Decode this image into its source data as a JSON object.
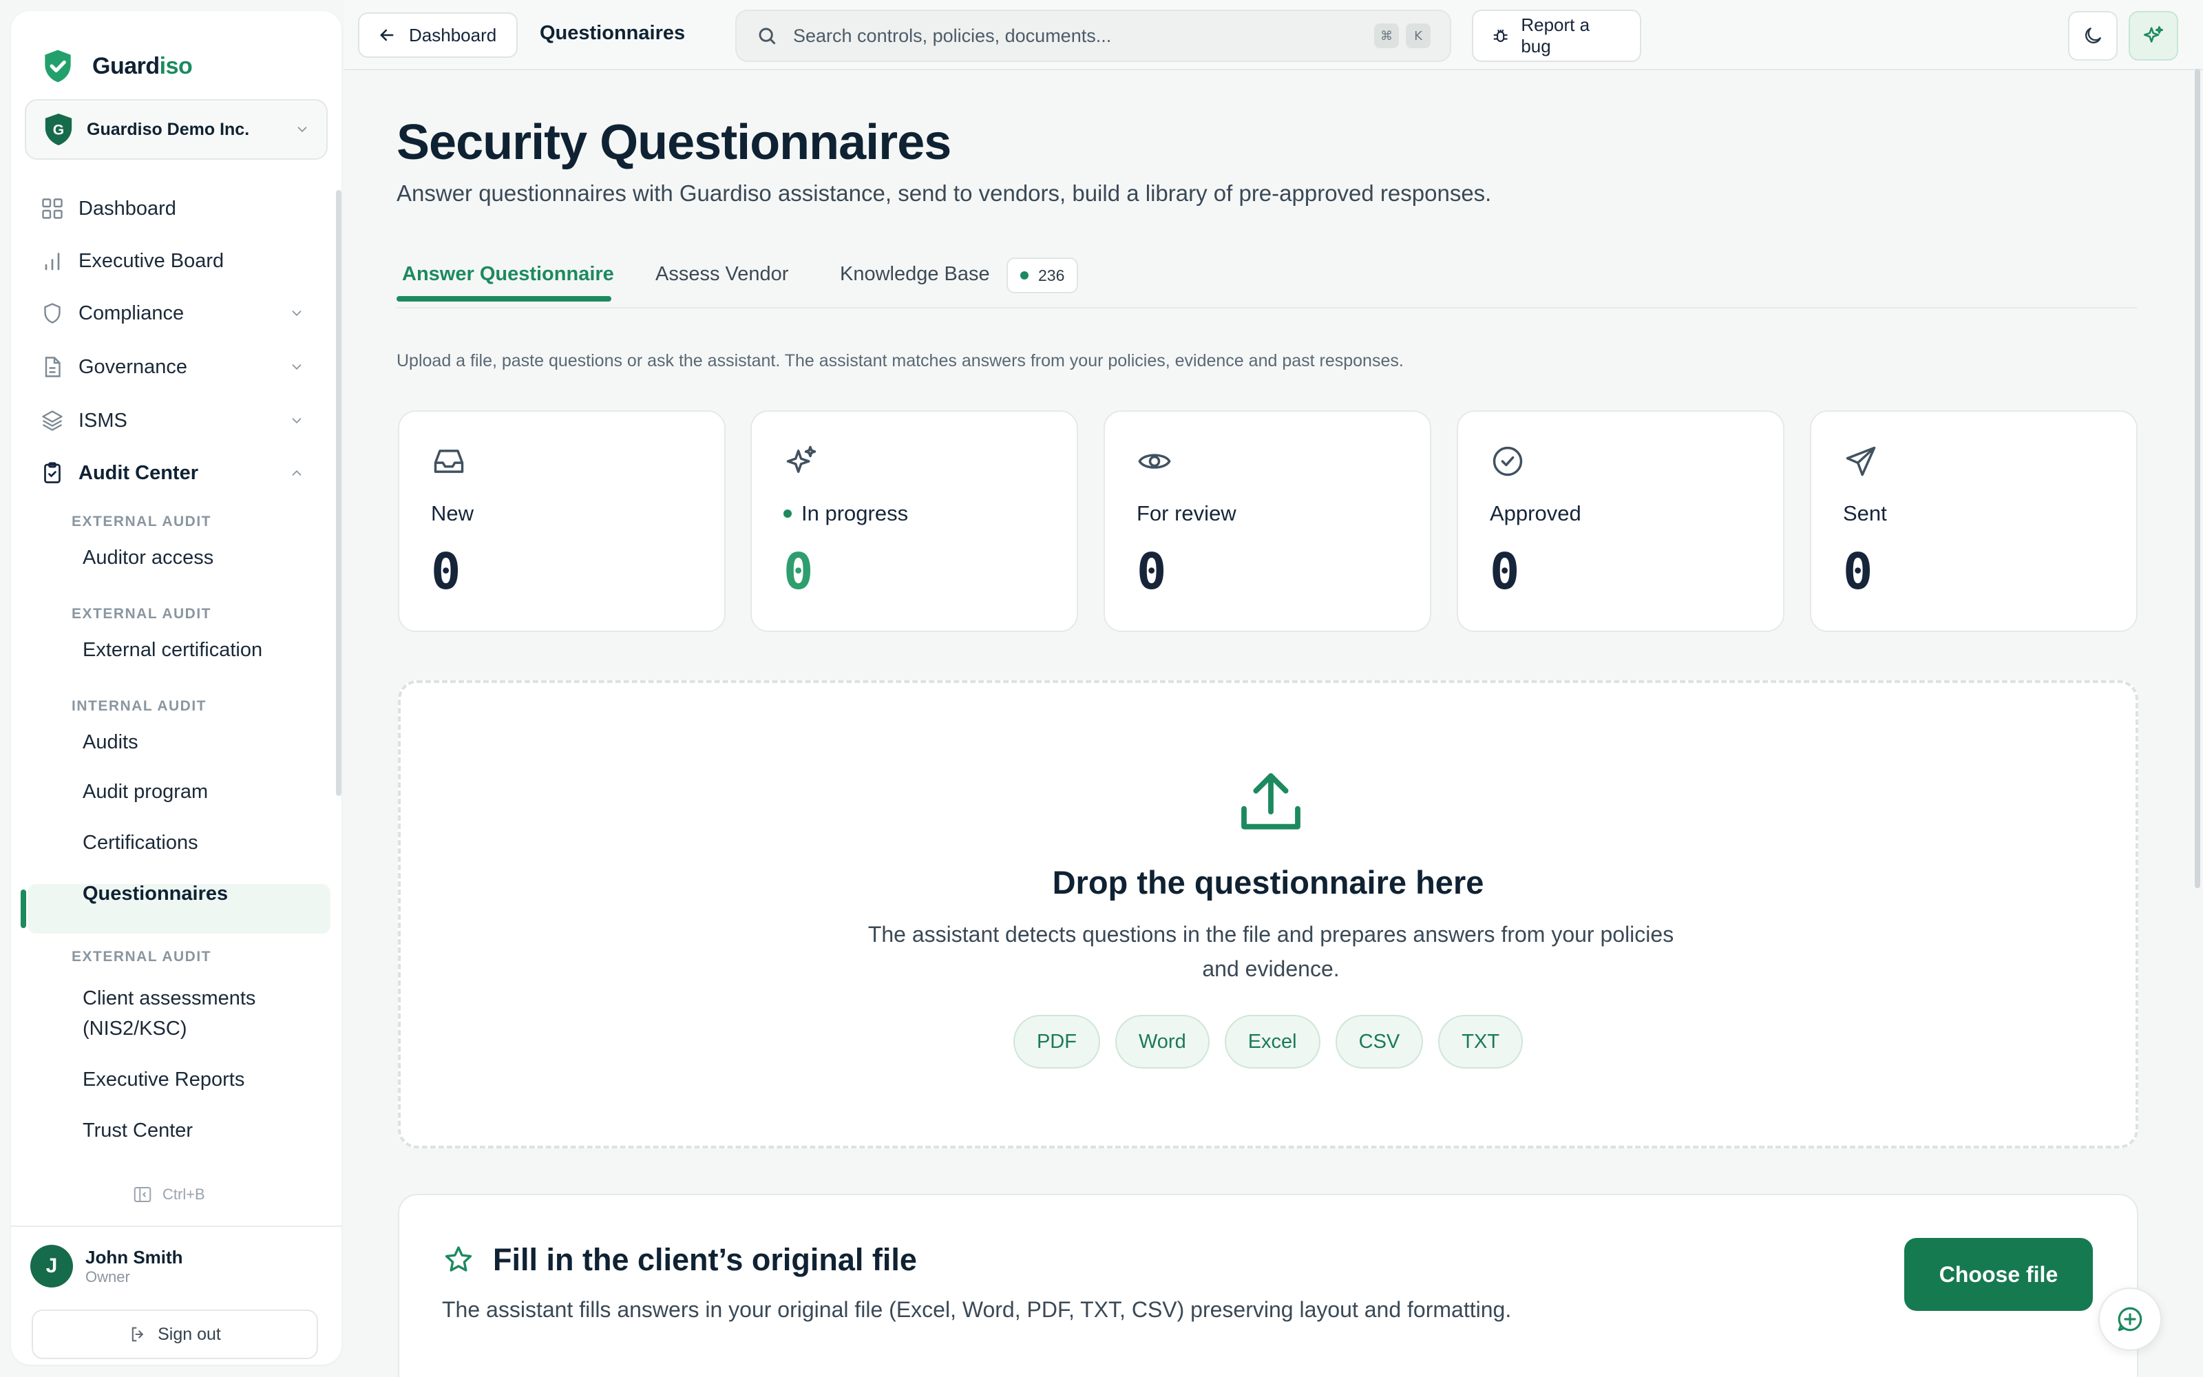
{
  "brand": {
    "name_a": "Guard",
    "name_b": "iso"
  },
  "org": {
    "initial": "G",
    "name": "Guardiso Demo Inc."
  },
  "nav": {
    "dashboard": "Dashboard",
    "executive_board": "Executive Board",
    "compliance": "Compliance",
    "governance": "Governance",
    "isms": "ISMS",
    "audit_center": "Audit Center"
  },
  "audit_sub": {
    "h1": "EXTERNAL AUDIT",
    "auditor_access": "Auditor access",
    "h2": "EXTERNAL AUDIT",
    "external_certification": "External certification",
    "h3": "INTERNAL AUDIT",
    "audits": "Audits",
    "audit_program": "Audit program",
    "certifications": "Certifications",
    "questionnaires": "Questionnaires",
    "h4": "EXTERNAL AUDIT",
    "client_assessments_1": "Client assessments",
    "client_assessments_2": "(NIS2/KSC)",
    "executive_reports": "Executive Reports",
    "trust_center": "Trust Center"
  },
  "collapse_hint": "Ctrl+B",
  "user": {
    "initial": "J",
    "name": "John Smith",
    "role": "Owner",
    "sign_out": "Sign out"
  },
  "topbar": {
    "back_label": "Dashboard",
    "crumb": "Questionnaires",
    "search_placeholder": "Search controls, policies, documents...",
    "kbd_1": "⌘",
    "kbd_2": "K",
    "report_bug": "Report a bug"
  },
  "page": {
    "title": "Security Questionnaires",
    "subtitle": "Answer questionnaires with Guardiso assistance, send to vendors, build a library of pre-approved responses.",
    "intro": "Upload a file, paste questions or ask the assistant. The assistant matches answers from your policies, evidence and past responses."
  },
  "tabs": {
    "answer": "Answer Questionnaire",
    "assess": "Assess Vendor",
    "kb": "Knowledge Base",
    "kb_count": "236"
  },
  "stats": [
    {
      "label": "New",
      "value": "0",
      "icon": "inbox-icon"
    },
    {
      "label": "In progress",
      "value": "0",
      "icon": "sparkles-icon"
    },
    {
      "label": "For review",
      "value": "0",
      "icon": "eye-icon"
    },
    {
      "label": "Approved",
      "value": "0",
      "icon": "check-circle-icon"
    },
    {
      "label": "Sent",
      "value": "0",
      "icon": "send-icon"
    }
  ],
  "drop": {
    "title": "Drop the questionnaire here",
    "desc": "The assistant detects questions in the file and prepares answers from your policies and evidence.",
    "formats": [
      "PDF",
      "Word",
      "Excel",
      "CSV",
      "TXT"
    ]
  },
  "fill": {
    "title": "Fill in the client’s original file",
    "desc": "The assistant fills answers in your original file (Excel, Word, PDF, TXT, CSV) preserving layout and formatting.",
    "button": "Choose file"
  },
  "colors": {
    "accent": "#1c8a5e",
    "accent_dark": "#167a51",
    "text": "#0f2233"
  }
}
